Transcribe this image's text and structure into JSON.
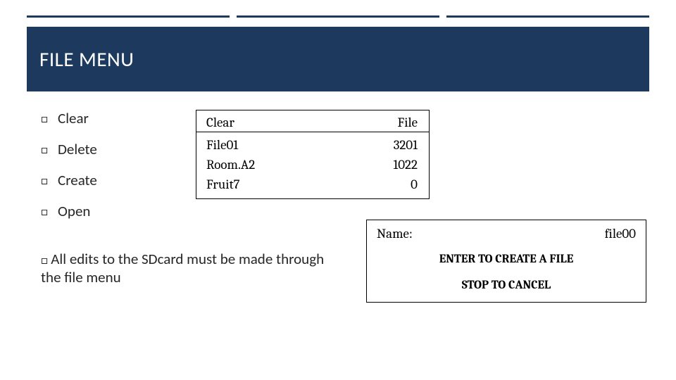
{
  "title": "FILE MENU",
  "bullets": {
    "items": [
      "Clear",
      "Delete",
      "Create",
      "Open"
    ],
    "marker": "□"
  },
  "note": {
    "marker": "□",
    "text": "All edits to the SDcard must be made through the file menu"
  },
  "panel1": {
    "headers": {
      "left": "Clear",
      "right": "File"
    },
    "rows": [
      {
        "name": "File01",
        "value": "3201"
      },
      {
        "name": "Room.A2",
        "value": "1022"
      },
      {
        "name": "Fruit7",
        "value": "0"
      }
    ]
  },
  "panel2": {
    "name_label": "Name:",
    "name_value": "file00",
    "line1": "ENTER TO CREATE A FILE",
    "line2": "STOP TO CANCEL"
  }
}
